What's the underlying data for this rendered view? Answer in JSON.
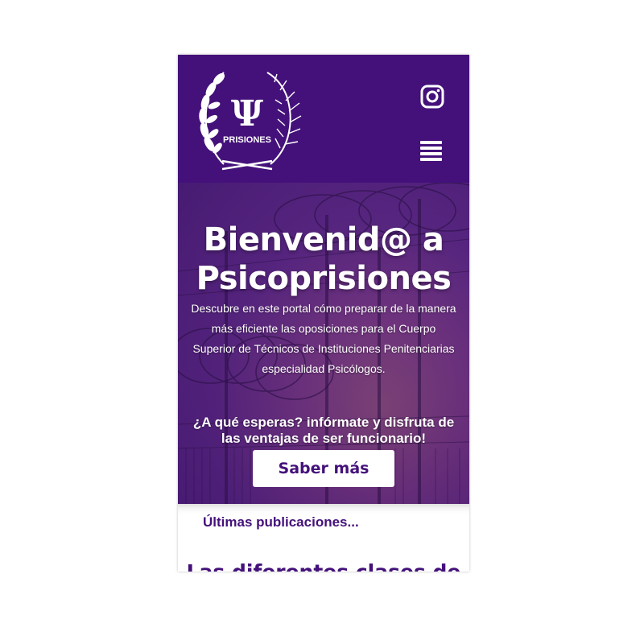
{
  "header": {
    "logo_text": "PRISIONES",
    "logo_symbol": "Ψ",
    "social_icon": "instagram-icon",
    "menu_icon": "hamburger-menu-icon"
  },
  "hero": {
    "title": "Bienvenid@ a Psicoprisiones",
    "description": "Descubre en este portal cómo preparar de la manera más eficiente las oposiciones para el Cuerpo Superior de Técnicos de Instituciones Penitenciarias especialidad Psicólogos.",
    "cta_text": "¿A qué esperas? infórmate y disfruta de las ventajas de ser funcionario!",
    "button_label": "Saber más"
  },
  "latest": {
    "label": "Últimas publicaciones...",
    "first_post_title": "Las diferentes clases de"
  },
  "colors": {
    "brand_purple": "#44117a",
    "white": "#ffffff"
  }
}
